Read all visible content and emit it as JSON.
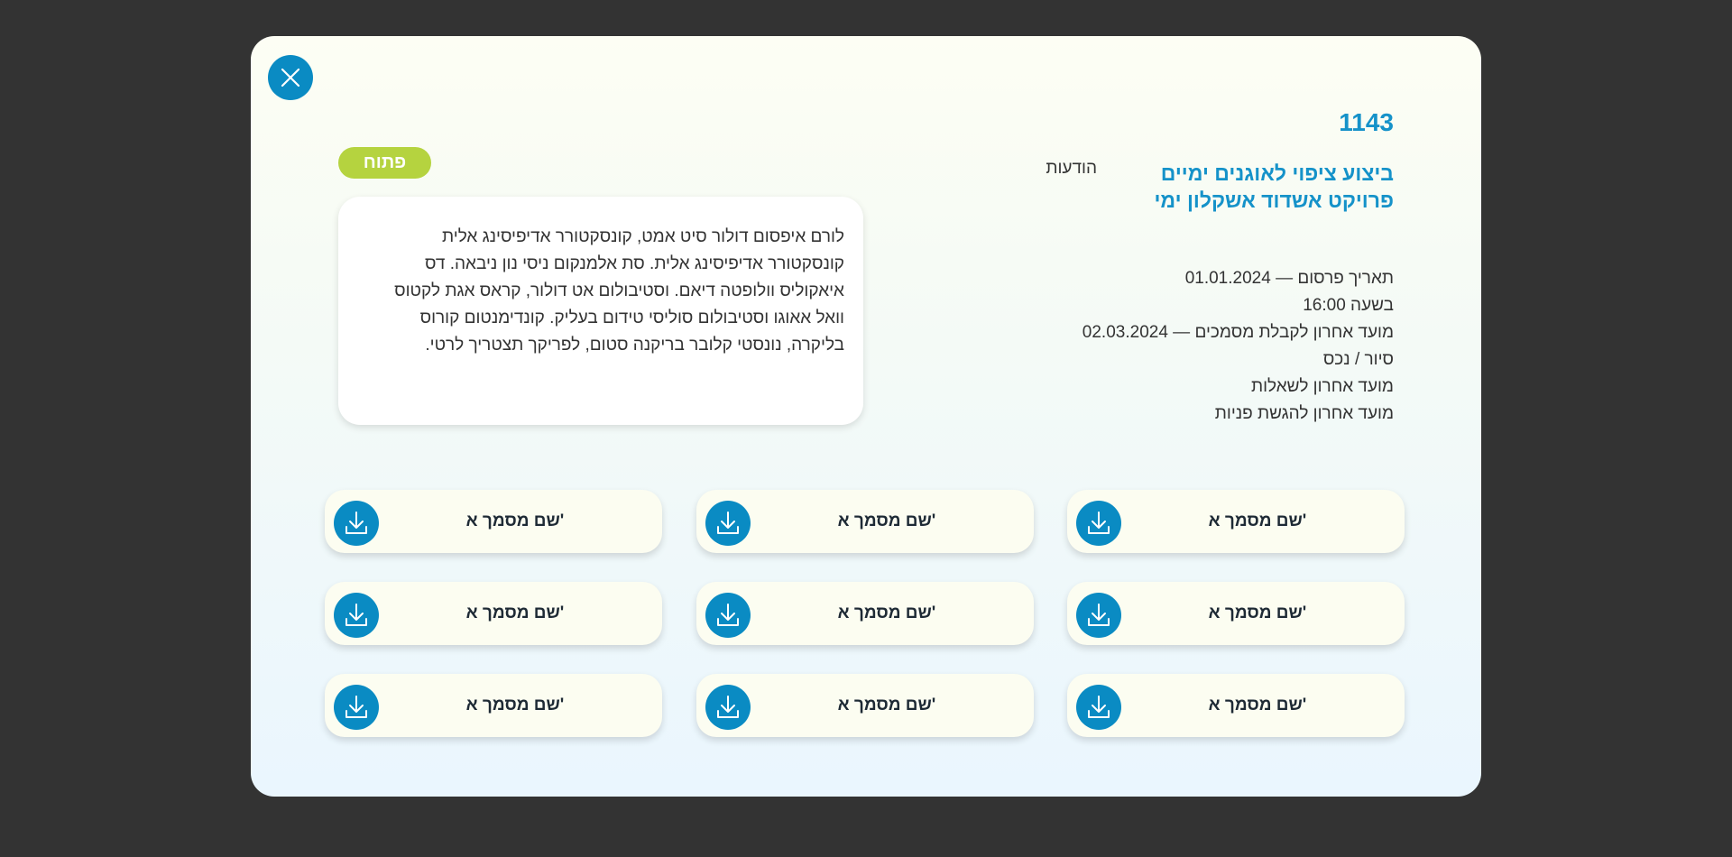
{
  "modal": {
    "close_icon": "close-icon",
    "tender_number": "1143",
    "title_line1": "ביצוע ציפוי לאוגנים ימיים",
    "title_line2": "פרויקט אשדוד אשקלון ימי",
    "details": [
      "תאריך פרסום — 01.01.2024",
      "בשעה 16:00",
      "מועד אחרון לקבלת מסמכים — 02.03.2024",
      "סיור / נכס",
      "מועד אחרון לשאלות",
      "מועד אחרון להגשת פניות"
    ],
    "notices_label": "הודעות",
    "status": "פתוח",
    "notices_text": "לורם איפסום דולור סיט אמט, קונסקטורר אדיפיסינג אלית קונסקטורר אדיפיסינג אלית. סת אלמנקום ניסי נון ניבאה. דס איאקוליס וולופטה דיאם. וסטיבולום אט דולור, קראס אגת לקטוס וואל אאוגו וסטיבולום סוליסי טידום בעליק. קונדימנטום קורוס בליקרה, נונסטי קלובר בריקנה סטום, לפריקך תצטריך לרטי.",
    "accent_color": "#0a8bc3",
    "status_color": "#b5d33f"
  },
  "documents": {
    "download_icon": "download-icon",
    "items": [
      "שם מסמך א'",
      "שם מסמך א'",
      "שם מסמך א'",
      "שם מסמך א'",
      "שם מסמך א'",
      "שם מסמך א'",
      "שם מסמך א'",
      "שם מסמך א'",
      "שם מסמך א'"
    ]
  }
}
